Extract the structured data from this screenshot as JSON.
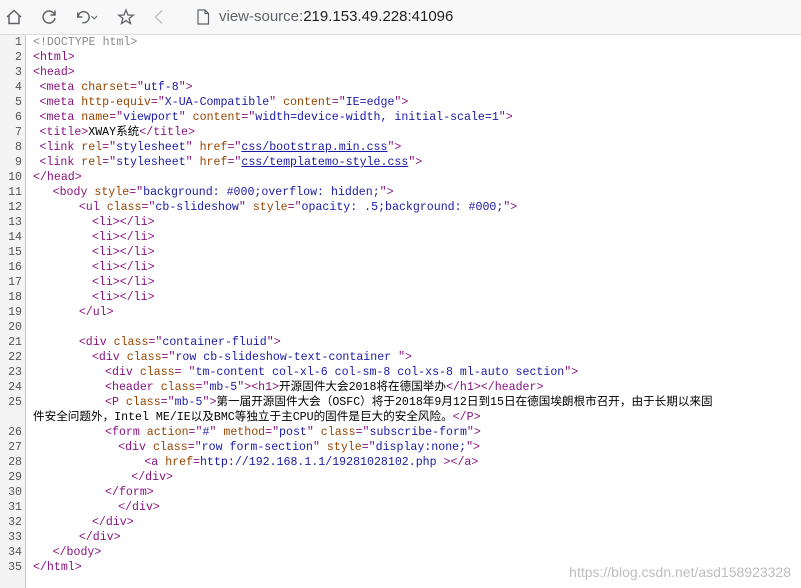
{
  "browser": {
    "address_scheme": "view-source:",
    "address_host": "219.153.49.228:41096"
  },
  "watermark": "https://blog.csdn.net/asd158923328",
  "source_lines": [
    {
      "n": "1",
      "indent": 0,
      "parts": [
        [
          "com",
          "<!DOCTYPE html>"
        ]
      ]
    },
    {
      "n": "2",
      "indent": 0,
      "parts": [
        [
          "tag",
          "<html>"
        ]
      ]
    },
    {
      "n": "3",
      "indent": 0,
      "parts": [
        [
          "tag",
          "<head>"
        ]
      ]
    },
    {
      "n": "4",
      "indent": 1,
      "parts": [
        [
          "tag",
          "<meta "
        ],
        [
          "att",
          "charset"
        ],
        [
          "tag",
          "=\""
        ],
        [
          "val",
          "utf-8"
        ],
        [
          "tag",
          "\">"
        ]
      ]
    },
    {
      "n": "5",
      "indent": 1,
      "parts": [
        [
          "tag",
          "<meta "
        ],
        [
          "att",
          "http-equiv"
        ],
        [
          "tag",
          "=\""
        ],
        [
          "val",
          "X-UA-Compatible"
        ],
        [
          "tag",
          "\" "
        ],
        [
          "att",
          "content"
        ],
        [
          "tag",
          "=\""
        ],
        [
          "val",
          "IE=edge"
        ],
        [
          "tag",
          "\">"
        ]
      ]
    },
    {
      "n": "6",
      "indent": 1,
      "parts": [
        [
          "tag",
          "<meta "
        ],
        [
          "att",
          "name"
        ],
        [
          "tag",
          "=\""
        ],
        [
          "val",
          "viewport"
        ],
        [
          "tag",
          "\" "
        ],
        [
          "att",
          "content"
        ],
        [
          "tag",
          "=\""
        ],
        [
          "val",
          "width=device-width, initial-scale=1"
        ],
        [
          "tag",
          "\">"
        ]
      ]
    },
    {
      "n": "7",
      "indent": 1,
      "parts": [
        [
          "tag",
          "<title>"
        ],
        [
          "txt",
          "XWAY系统"
        ],
        [
          "tag",
          "</title>"
        ]
      ]
    },
    {
      "n": "8",
      "indent": 1,
      "parts": [
        [
          "tag",
          "<link "
        ],
        [
          "att",
          "rel"
        ],
        [
          "tag",
          "=\""
        ],
        [
          "val",
          "stylesheet"
        ],
        [
          "tag",
          "\" "
        ],
        [
          "att",
          "href"
        ],
        [
          "tag",
          "=\""
        ],
        [
          "lnk",
          "css/bootstrap.min.css"
        ],
        [
          "tag",
          "\">"
        ]
      ]
    },
    {
      "n": "9",
      "indent": 1,
      "parts": [
        [
          "tag",
          "<link "
        ],
        [
          "att",
          "rel"
        ],
        [
          "tag",
          "=\""
        ],
        [
          "val",
          "stylesheet"
        ],
        [
          "tag",
          "\" "
        ],
        [
          "att",
          "href"
        ],
        [
          "tag",
          "=\""
        ],
        [
          "lnk",
          "css/templatemo-style.css"
        ],
        [
          "tag",
          "\">"
        ]
      ]
    },
    {
      "n": "10",
      "indent": 0,
      "parts": [
        [
          "tag",
          "</head>"
        ]
      ]
    },
    {
      "n": "11",
      "indent": 3,
      "parts": [
        [
          "tag",
          "<body "
        ],
        [
          "att",
          "style"
        ],
        [
          "tag",
          "=\""
        ],
        [
          "val",
          "background: #000;overflow: hidden;"
        ],
        [
          "tag",
          "\">"
        ]
      ]
    },
    {
      "n": "12",
      "indent": 7,
      "parts": [
        [
          "tag",
          "<ul "
        ],
        [
          "att",
          "class"
        ],
        [
          "tag",
          "=\""
        ],
        [
          "val",
          "cb-slideshow"
        ],
        [
          "tag",
          "\" "
        ],
        [
          "att",
          "style"
        ],
        [
          "tag",
          "=\""
        ],
        [
          "val",
          "opacity: .5;background: #000;"
        ],
        [
          "tag",
          "\">"
        ]
      ]
    },
    {
      "n": "13",
      "indent": 9,
      "parts": [
        [
          "tag",
          "<li></li>"
        ]
      ]
    },
    {
      "n": "14",
      "indent": 9,
      "parts": [
        [
          "tag",
          "<li></li>"
        ]
      ]
    },
    {
      "n": "15",
      "indent": 9,
      "parts": [
        [
          "tag",
          "<li></li>"
        ]
      ]
    },
    {
      "n": "16",
      "indent": 9,
      "parts": [
        [
          "tag",
          "<li></li>"
        ]
      ]
    },
    {
      "n": "17",
      "indent": 9,
      "parts": [
        [
          "tag",
          "<li></li>"
        ]
      ]
    },
    {
      "n": "18",
      "indent": 9,
      "parts": [
        [
          "tag",
          "<li></li>"
        ]
      ]
    },
    {
      "n": "19",
      "indent": 7,
      "parts": [
        [
          "tag",
          "</ul>"
        ]
      ]
    },
    {
      "n": "20",
      "indent": 0,
      "parts": []
    },
    {
      "n": "21",
      "indent": 7,
      "parts": [
        [
          "tag",
          "<div "
        ],
        [
          "att",
          "class"
        ],
        [
          "tag",
          "=\""
        ],
        [
          "val",
          "container-fluid"
        ],
        [
          "tag",
          "\">"
        ]
      ]
    },
    {
      "n": "22",
      "indent": 9,
      "parts": [
        [
          "tag",
          "<div "
        ],
        [
          "att",
          "class"
        ],
        [
          "tag",
          "=\""
        ],
        [
          "val",
          "row cb-slideshow-text-container "
        ],
        [
          "tag",
          "\">"
        ]
      ]
    },
    {
      "n": "23",
      "indent": 11,
      "parts": [
        [
          "tag",
          "<div "
        ],
        [
          "att",
          "class"
        ],
        [
          "tag",
          "= \""
        ],
        [
          "val",
          "tm-content col-xl-6 col-sm-8 col-xs-8 ml-auto section"
        ],
        [
          "tag",
          "\">"
        ]
      ]
    },
    {
      "n": "24",
      "indent": 11,
      "parts": [
        [
          "tag",
          "<header "
        ],
        [
          "att",
          "class"
        ],
        [
          "tag",
          "=\""
        ],
        [
          "val",
          "mb-5"
        ],
        [
          "tag",
          "\"><h1>"
        ],
        [
          "txt",
          "开源固件大会2018将在德国举办"
        ],
        [
          "tag",
          "</h1></header>"
        ]
      ]
    },
    {
      "n": "25",
      "indent": 11,
      "parts": [
        [
          "tag",
          "<P "
        ],
        [
          "att",
          "class"
        ],
        [
          "tag",
          "=\""
        ],
        [
          "val",
          "mb-5"
        ],
        [
          "tag",
          "\">"
        ],
        [
          "txt",
          "第一届开源固件大会（OSFC）将于2018年9月12日到15日在德国埃朗根市召开，由于长期以来固"
        ]
      ]
    },
    {
      "n": "",
      "indent": -1,
      "parts": [
        [
          "txt",
          "件安全问题外，Intel ME/IE以及BMC等独立于主CPU的固件是巨大的安全风险。"
        ],
        [
          "tag",
          "</P>"
        ]
      ]
    },
    {
      "n": "26",
      "indent": 11,
      "parts": [
        [
          "tag",
          "<form "
        ],
        [
          "att",
          "action"
        ],
        [
          "tag",
          "=\""
        ],
        [
          "val",
          "#"
        ],
        [
          "tag",
          "\" "
        ],
        [
          "att",
          "method"
        ],
        [
          "tag",
          "=\""
        ],
        [
          "val",
          "post"
        ],
        [
          "tag",
          "\" "
        ],
        [
          "att",
          "class"
        ],
        [
          "tag",
          "=\""
        ],
        [
          "val",
          "subscribe-form"
        ],
        [
          "tag",
          "\">"
        ]
      ]
    },
    {
      "n": "27",
      "indent": 13,
      "parts": [
        [
          "tag",
          "<div "
        ],
        [
          "att",
          "class"
        ],
        [
          "tag",
          "=\""
        ],
        [
          "val",
          "row form-section"
        ],
        [
          "tag",
          "\" "
        ],
        [
          "att",
          "style"
        ],
        [
          "tag",
          "=\""
        ],
        [
          "val",
          "display:none;"
        ],
        [
          "tag",
          "\">"
        ]
      ]
    },
    {
      "n": "28",
      "indent": 17,
      "parts": [
        [
          "tag",
          "<a "
        ],
        [
          "att",
          "href"
        ],
        [
          "tag",
          "="
        ],
        [
          "val",
          "http://192.168.1.1/19281028102.php"
        ],
        [
          "tag",
          " ></a>"
        ]
      ]
    },
    {
      "n": "29",
      "indent": 15,
      "parts": [
        [
          "tag",
          "</div>"
        ]
      ]
    },
    {
      "n": "30",
      "indent": 11,
      "parts": [
        [
          "tag",
          "</form>"
        ]
      ]
    },
    {
      "n": "31",
      "indent": 13,
      "parts": [
        [
          "tag",
          "</div>"
        ]
      ]
    },
    {
      "n": "32",
      "indent": 9,
      "parts": [
        [
          "tag",
          "</div>"
        ]
      ]
    },
    {
      "n": "33",
      "indent": 7,
      "parts": [
        [
          "tag",
          "</div>"
        ]
      ]
    },
    {
      "n": "34",
      "indent": 3,
      "parts": [
        [
          "tag",
          "</body>"
        ]
      ]
    },
    {
      "n": "35",
      "indent": 0,
      "parts": [
        [
          "tag",
          "</html>"
        ]
      ]
    }
  ]
}
